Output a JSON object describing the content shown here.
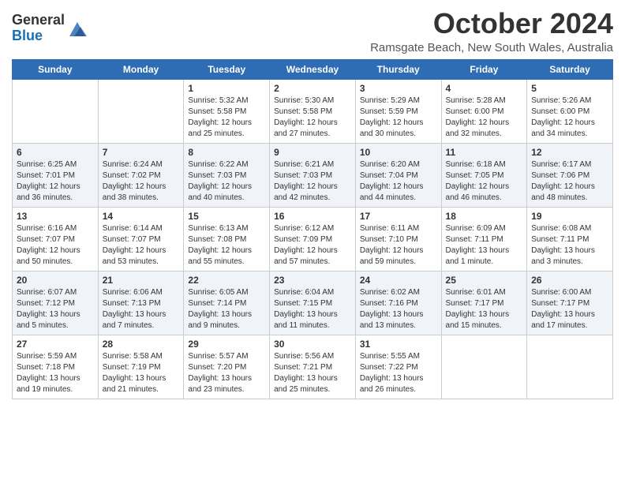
{
  "header": {
    "logo_general": "General",
    "logo_blue": "Blue",
    "month": "October 2024",
    "location": "Ramsgate Beach, New South Wales, Australia"
  },
  "weekdays": [
    "Sunday",
    "Monday",
    "Tuesday",
    "Wednesday",
    "Thursday",
    "Friday",
    "Saturday"
  ],
  "weeks": [
    [
      {
        "day": "",
        "info": ""
      },
      {
        "day": "",
        "info": ""
      },
      {
        "day": "1",
        "info": "Sunrise: 5:32 AM\nSunset: 5:58 PM\nDaylight: 12 hours\nand 25 minutes."
      },
      {
        "day": "2",
        "info": "Sunrise: 5:30 AM\nSunset: 5:58 PM\nDaylight: 12 hours\nand 27 minutes."
      },
      {
        "day": "3",
        "info": "Sunrise: 5:29 AM\nSunset: 5:59 PM\nDaylight: 12 hours\nand 30 minutes."
      },
      {
        "day": "4",
        "info": "Sunrise: 5:28 AM\nSunset: 6:00 PM\nDaylight: 12 hours\nand 32 minutes."
      },
      {
        "day": "5",
        "info": "Sunrise: 5:26 AM\nSunset: 6:00 PM\nDaylight: 12 hours\nand 34 minutes."
      }
    ],
    [
      {
        "day": "6",
        "info": "Sunrise: 6:25 AM\nSunset: 7:01 PM\nDaylight: 12 hours\nand 36 minutes."
      },
      {
        "day": "7",
        "info": "Sunrise: 6:24 AM\nSunset: 7:02 PM\nDaylight: 12 hours\nand 38 minutes."
      },
      {
        "day": "8",
        "info": "Sunrise: 6:22 AM\nSunset: 7:03 PM\nDaylight: 12 hours\nand 40 minutes."
      },
      {
        "day": "9",
        "info": "Sunrise: 6:21 AM\nSunset: 7:03 PM\nDaylight: 12 hours\nand 42 minutes."
      },
      {
        "day": "10",
        "info": "Sunrise: 6:20 AM\nSunset: 7:04 PM\nDaylight: 12 hours\nand 44 minutes."
      },
      {
        "day": "11",
        "info": "Sunrise: 6:18 AM\nSunset: 7:05 PM\nDaylight: 12 hours\nand 46 minutes."
      },
      {
        "day": "12",
        "info": "Sunrise: 6:17 AM\nSunset: 7:06 PM\nDaylight: 12 hours\nand 48 minutes."
      }
    ],
    [
      {
        "day": "13",
        "info": "Sunrise: 6:16 AM\nSunset: 7:07 PM\nDaylight: 12 hours\nand 50 minutes."
      },
      {
        "day": "14",
        "info": "Sunrise: 6:14 AM\nSunset: 7:07 PM\nDaylight: 12 hours\nand 53 minutes."
      },
      {
        "day": "15",
        "info": "Sunrise: 6:13 AM\nSunset: 7:08 PM\nDaylight: 12 hours\nand 55 minutes."
      },
      {
        "day": "16",
        "info": "Sunrise: 6:12 AM\nSunset: 7:09 PM\nDaylight: 12 hours\nand 57 minutes."
      },
      {
        "day": "17",
        "info": "Sunrise: 6:11 AM\nSunset: 7:10 PM\nDaylight: 12 hours\nand 59 minutes."
      },
      {
        "day": "18",
        "info": "Sunrise: 6:09 AM\nSunset: 7:11 PM\nDaylight: 13 hours\nand 1 minute."
      },
      {
        "day": "19",
        "info": "Sunrise: 6:08 AM\nSunset: 7:11 PM\nDaylight: 13 hours\nand 3 minutes."
      }
    ],
    [
      {
        "day": "20",
        "info": "Sunrise: 6:07 AM\nSunset: 7:12 PM\nDaylight: 13 hours\nand 5 minutes."
      },
      {
        "day": "21",
        "info": "Sunrise: 6:06 AM\nSunset: 7:13 PM\nDaylight: 13 hours\nand 7 minutes."
      },
      {
        "day": "22",
        "info": "Sunrise: 6:05 AM\nSunset: 7:14 PM\nDaylight: 13 hours\nand 9 minutes."
      },
      {
        "day": "23",
        "info": "Sunrise: 6:04 AM\nSunset: 7:15 PM\nDaylight: 13 hours\nand 11 minutes."
      },
      {
        "day": "24",
        "info": "Sunrise: 6:02 AM\nSunset: 7:16 PM\nDaylight: 13 hours\nand 13 minutes."
      },
      {
        "day": "25",
        "info": "Sunrise: 6:01 AM\nSunset: 7:17 PM\nDaylight: 13 hours\nand 15 minutes."
      },
      {
        "day": "26",
        "info": "Sunrise: 6:00 AM\nSunset: 7:17 PM\nDaylight: 13 hours\nand 17 minutes."
      }
    ],
    [
      {
        "day": "27",
        "info": "Sunrise: 5:59 AM\nSunset: 7:18 PM\nDaylight: 13 hours\nand 19 minutes."
      },
      {
        "day": "28",
        "info": "Sunrise: 5:58 AM\nSunset: 7:19 PM\nDaylight: 13 hours\nand 21 minutes."
      },
      {
        "day": "29",
        "info": "Sunrise: 5:57 AM\nSunset: 7:20 PM\nDaylight: 13 hours\nand 23 minutes."
      },
      {
        "day": "30",
        "info": "Sunrise: 5:56 AM\nSunset: 7:21 PM\nDaylight: 13 hours\nand 25 minutes."
      },
      {
        "day": "31",
        "info": "Sunrise: 5:55 AM\nSunset: 7:22 PM\nDaylight: 13 hours\nand 26 minutes."
      },
      {
        "day": "",
        "info": ""
      },
      {
        "day": "",
        "info": ""
      }
    ]
  ]
}
